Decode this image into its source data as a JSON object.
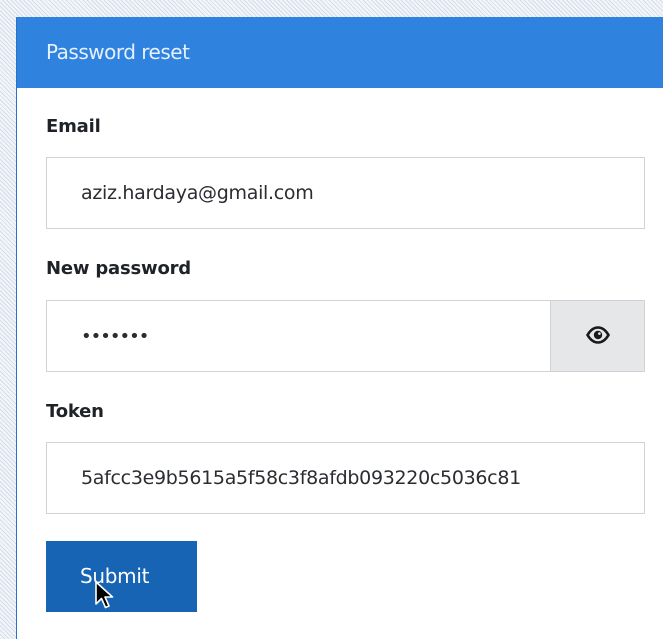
{
  "panel": {
    "title": "Password reset"
  },
  "form": {
    "email": {
      "label": "Email",
      "value": "aziz.hardaya@gmail.com"
    },
    "new_password": {
      "label": "New password",
      "masked_value": "•••••••",
      "toggle_icon": "eye-icon"
    },
    "token": {
      "label": "Token",
      "value": "5afcc3e9b5615a5f58c3f8afdb093220c5036c81"
    },
    "submit_label": "Submit"
  },
  "colors": {
    "header": "#2f82de",
    "submit_button": "#1764b5",
    "toggle_background": "#e6e7e9"
  }
}
